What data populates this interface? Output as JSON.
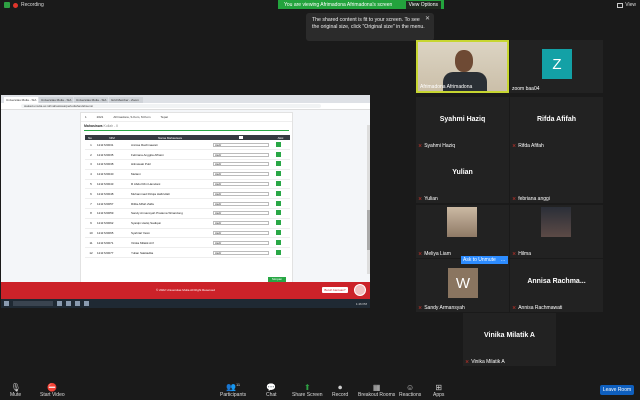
{
  "top": {
    "recording_label": "Recording",
    "share_banner": "You are viewing Afrimadona Afrimadona's screen",
    "view_options": "View Options",
    "view_button": "View"
  },
  "tooltip": {
    "text": "The shared content is fit to your screen. To see the original size, click \"Original size\" in the menu."
  },
  "shared_screen": {
    "browser_tabs": [
      "Universitas Mulia - SIA",
      "Universitas Mulia - SIA",
      "Universitas Mulia - SIA",
      "Grid Member - Zoom"
    ],
    "url": "siakad.umulia.ac.id/mahasiswa/perkuliahan/absensi",
    "prev_row": [
      "1",
      "2021",
      "Afrimadona, S.Kom, M.Kom",
      "Tepat"
    ],
    "section_title": "Mahasiswa",
    "section_sub": "Kuliah - II",
    "columns": [
      "No",
      "NIM",
      "Nama Mahasiswa",
      "",
      "Aksi"
    ],
    "rows": [
      {
        "no": "1",
        "nim": "1211720031",
        "name": "Annisa Rachmawati",
        "status": "Hadir"
      },
      {
        "no": "2",
        "nim": "1211720035",
        "name": "Febriana Anggita Affraini",
        "status": "Hadir"
      },
      {
        "no": "3",
        "nim": "1211720038",
        "name": "Hilmawati Putri",
        "status": "Hadir"
      },
      {
        "no": "4",
        "nim": "1211720040",
        "name": "Meliani",
        "status": "Hadir"
      },
      {
        "no": "5",
        "nim": "1211720043",
        "name": "R Abdul Rini Hamdani",
        "status": "Hadir"
      },
      {
        "no": "6",
        "nim": "1211720048",
        "name": "Muhammad Rizqia Hafizullah",
        "status": "Hadir"
      },
      {
        "no": "7",
        "nim": "1211720057",
        "name": "Rifda Afifah Zalfa",
        "status": "Hadir"
      },
      {
        "no": "8",
        "nim": "1211720059",
        "name": "Sandy Armansyah Pratama Winardong",
        "status": "Hadir"
      },
      {
        "no": "9",
        "nim": "1211720062",
        "name": "Syaiqin Haziq Sadiqun",
        "status": "Hadir"
      },
      {
        "no": "10",
        "nim": "1211720065",
        "name": "Syahrial Yasin",
        "status": "Hadir"
      },
      {
        "no": "11",
        "nim": "1211720071",
        "name": "Vinika Milatik Arif",
        "status": "Hadir"
      },
      {
        "no": "12",
        "nim": "1211720077",
        "name": "Yulian Saktiadita",
        "status": "Hadir"
      }
    ],
    "save_button": "Simpan",
    "footer_text": "© 2022 Universitas Mulia All Right Reserved",
    "footer_chat": "Butuh bantuan?",
    "taskbar_time": "1:46 PM"
  },
  "participants": [
    {
      "id": "afrimadona",
      "label": "Afrimadona Afrimadona",
      "kind": "video",
      "muted": false,
      "active": true
    },
    {
      "id": "zoom",
      "label": "zoom baa04",
      "kind": "avatar",
      "letter": "Z",
      "color": "#13a1a6",
      "muted": false
    },
    {
      "id": "syahmi",
      "label": "Syahmi Haziq",
      "kind": "name",
      "center": "Syahmi Haziq",
      "muted": true
    },
    {
      "id": "rifda",
      "label": "Rifda Afifah",
      "kind": "name",
      "center": "Rifda Afifah",
      "muted": true
    },
    {
      "id": "yulian",
      "label": "Yulian",
      "kind": "name",
      "center": "Yulian",
      "muted": true
    },
    {
      "id": "febriana",
      "label": "febriana anggi",
      "kind": "name",
      "center": "",
      "muted": true
    },
    {
      "id": "meliya",
      "label": "Meliya Liam",
      "kind": "photo",
      "muted": true
    },
    {
      "id": "hilma",
      "label": "Hilma",
      "kind": "photo",
      "muted": true
    },
    {
      "id": "sandy",
      "label": "Sandy Armansyah",
      "kind": "avatar",
      "letter": "W",
      "color": "#8a7560",
      "muted": true
    },
    {
      "id": "annisa",
      "label": "Annisa Rachmawati",
      "kind": "name",
      "center": "Annisa  Rachma...",
      "muted": true
    },
    {
      "id": "vinika",
      "label": "Vinika Milatik A",
      "kind": "name",
      "center": "Vinika Milatik A",
      "muted": true
    }
  ],
  "tile_actions": {
    "ask": "Ask to Unmute",
    "more": "..."
  },
  "toolbar": {
    "mute": "Mute",
    "video": "Start Video",
    "participants": "Participants",
    "participants_count": "11",
    "chat": "Chat",
    "share": "Share Screen",
    "record": "Record",
    "breakout": "Breakout Rooms",
    "reactions": "Reactions",
    "apps": "Apps",
    "leave": "Leave Room"
  }
}
